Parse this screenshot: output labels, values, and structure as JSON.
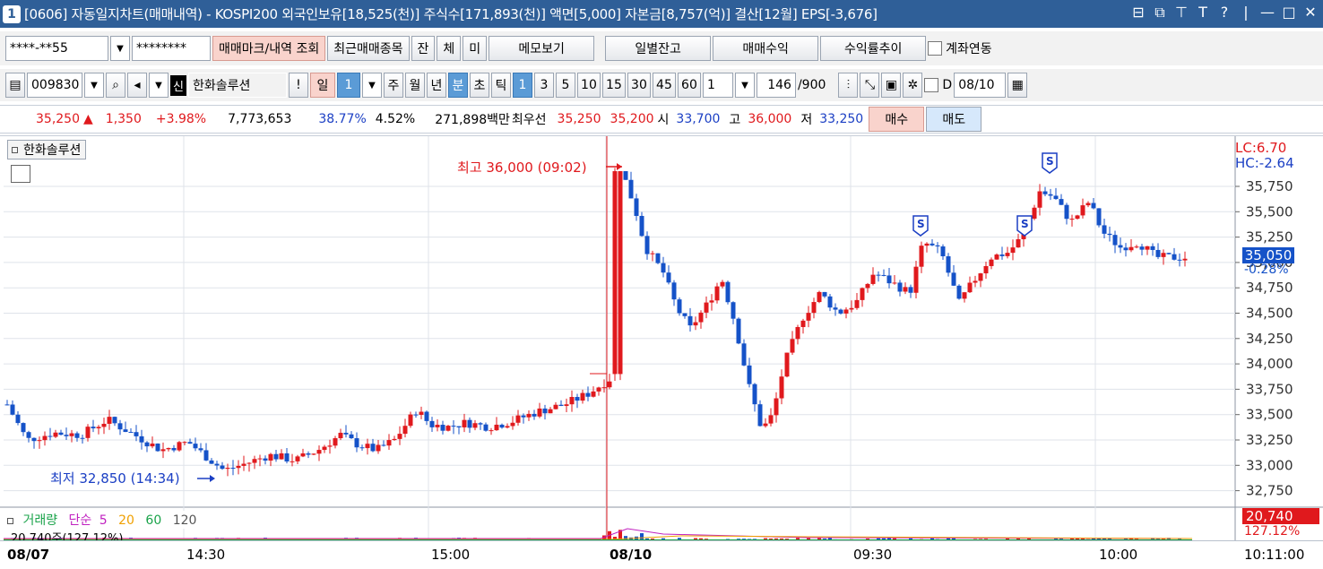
{
  "window": {
    "number": "1",
    "title": "[0606] 자동일지차트(매매내역) - KOSPI200 외국인보유[18,525(천)] 주식수[171,893(천)] 액면[5,000] 자본금[8,757(억)] 결산[12월] EPS[-3,676]",
    "controls": [
      "⊟",
      "⧉",
      "⊤",
      "T",
      "?",
      "|",
      "—",
      "□",
      "✕"
    ]
  },
  "toolbar1": {
    "account": "****-**55",
    "password": "********",
    "trade_mark_btn": "매매마크/내역 조회",
    "recent_btn": "최근매매종목",
    "tab_jan": "잔",
    "tab_che": "체",
    "tab_mi": "미",
    "memo_btn": "메모보기",
    "daily_btn": "일별잔고",
    "profit_btn": "매매수익",
    "rate_btn": "수익률추이",
    "link_label": "계좌연동"
  },
  "toolbar2": {
    "code": "009830",
    "badge": "신",
    "stock_name": "한화솔루션",
    "bang": "!",
    "period_day": "일",
    "period_num": "1",
    "week": "주",
    "month": "월",
    "year": "년",
    "minute": "분",
    "second": "초",
    "tick": "틱",
    "intervals": [
      "1",
      "3",
      "5",
      "10",
      "15",
      "30",
      "45",
      "60"
    ],
    "count_value": "1",
    "bars_value": "146",
    "bars_total": "/900",
    "d_label": "D",
    "date_value": "08/10"
  },
  "quote": {
    "price": "35,250",
    "arrow": "▲",
    "change": "1,350",
    "pct": "+3.98%",
    "volume": "7,773,653",
    "v1": "38.77%",
    "v2": "4.52%",
    "amount": "271,898백만",
    "best_label": "최우선",
    "ask": "35,250",
    "bid": "35,200",
    "open_label": "시",
    "open": "33,700",
    "high_label": "고",
    "high": "36,000",
    "low_label": "저",
    "low": "33,250",
    "buy_btn": "매수",
    "sell_btn": "매도"
  },
  "chart": {
    "legend_name": "한화솔루션",
    "lc": "LC:6.70",
    "hc": "HC:-2.64",
    "current_price": "35,050",
    "current_chg": "-0.28%",
    "high_annot": "최고 36,000 (09:02)",
    "low_annot": "최저 32,850 (14:34)",
    "vol_legend": {
      "name": "거래량",
      "type": "단순",
      "ma": [
        "5",
        "20",
        "60",
        "120"
      ]
    },
    "vol_sub": "20,740주(127.12%)",
    "vol_tag": "20,740",
    "vol_chg": "127.12%",
    "x_labels": [
      "08/07",
      "14:30",
      "15:00",
      "08/10",
      "09:30",
      "10:00",
      "10:11:00"
    ],
    "colors": {
      "up": "#e0191d",
      "down": "#1552c8",
      "grid": "#dfe3ea"
    }
  },
  "chart_data": {
    "type": "candlestick",
    "y_ticks": [
      35750,
      35500,
      35250,
      35000,
      34750,
      34500,
      34250,
      34000,
      33750,
      33500,
      33250,
      33000,
      32750
    ],
    "ylim": [
      32600,
      36200
    ],
    "x_labels": [
      "08/07",
      "14:30",
      "15:00",
      "08/10",
      "09:30",
      "10:00",
      "10:11:00"
    ],
    "high": {
      "value": 36000,
      "time": "09:02"
    },
    "low": {
      "value": 32850,
      "time": "14:34"
    },
    "current": 35050,
    "sell_marks": 4
  }
}
